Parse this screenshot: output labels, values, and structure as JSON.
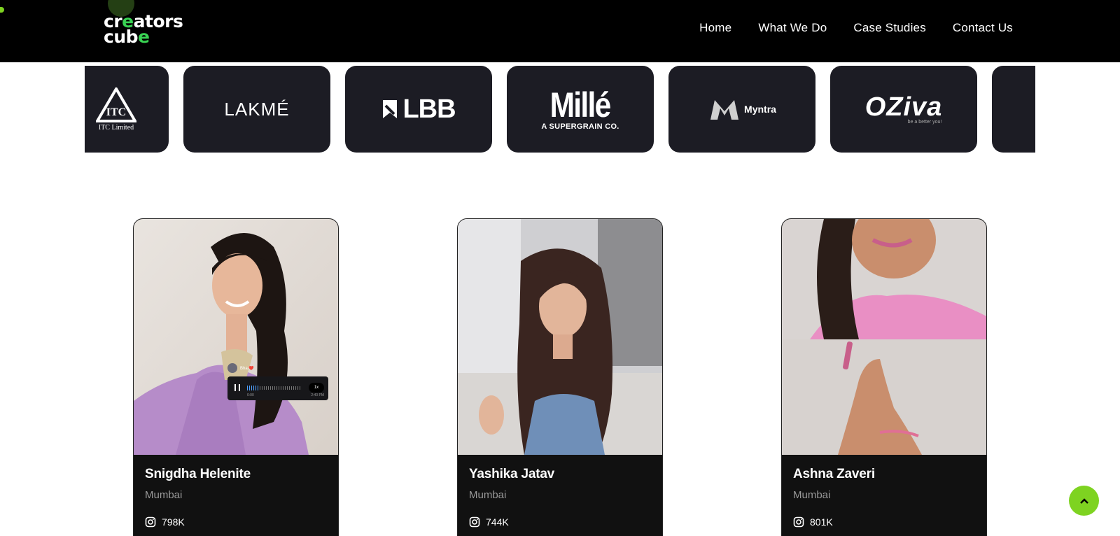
{
  "header": {
    "logo_line1": "creators",
    "logo_line2": "cube",
    "nav": [
      "Home",
      "What We Do",
      "Case Studies",
      "Contact Us"
    ]
  },
  "brands": {
    "itc": "ITC Limited",
    "lakme": "LAKMÉ",
    "lbb": "LBB",
    "mille_main": "Millé",
    "mille_sub": "A SUPERGRAIN CO.",
    "myntra": "Myntra",
    "oziva_main": "OZiva",
    "oziva_sub": "be a better you!"
  },
  "creators": [
    {
      "name": "Snigdha Helenite",
      "city": "Mumbai",
      "followers": "798K"
    },
    {
      "name": "Yashika Jatav",
      "city": "Mumbai",
      "followers": "744K"
    },
    {
      "name": "Ashna Zaveri",
      "city": "Mumbai",
      "followers": "801K"
    }
  ],
  "audio_widget": {
    "sender": "Bhai❤️",
    "speed": "1x",
    "elapsed": "0:00",
    "time": "2:40 PM",
    "progress": 0.2
  },
  "colors": {
    "accent_green": "#7ed321",
    "header_bg": "#000000",
    "tile_bg": "#1c1c24",
    "card_bg": "#111111"
  },
  "icons": [
    "instagram-icon",
    "chevron-up-icon",
    "pause-icon"
  ]
}
